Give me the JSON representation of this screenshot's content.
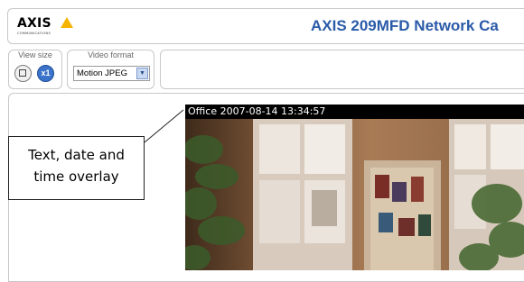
{
  "header": {
    "logo_text": "AXIS",
    "logo_subtext": "COMMUNICATIONS",
    "product_title": "AXIS 209MFD Network Ca"
  },
  "toolbar": {
    "view_size": {
      "label": "View size",
      "buttons": [
        {
          "name": "fit",
          "icon": "fit-window-icon"
        },
        {
          "name": "full",
          "text": "x1",
          "icon": "actual-size-icon"
        }
      ]
    },
    "video_format": {
      "label": "Video format",
      "selected": "Motion JPEG"
    }
  },
  "video": {
    "overlay_text": "Office 2007-08-14 13:34:57"
  },
  "callout": {
    "text_line1": "Text, date and",
    "text_line2": "time overlay"
  },
  "colors": {
    "title_blue": "#2a5aa8",
    "logo_yellow": "#f5b400",
    "overlay_bg": "#000000"
  }
}
